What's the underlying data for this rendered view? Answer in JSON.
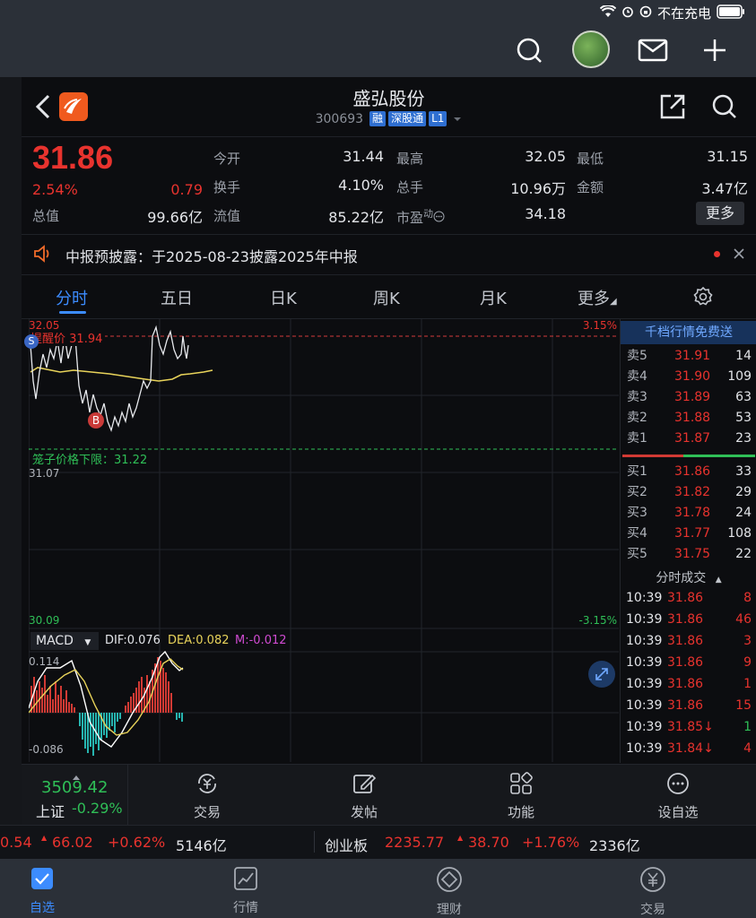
{
  "status": {
    "charging_text": "不在充电"
  },
  "stock": {
    "name": "盛弘股份",
    "code": "300693",
    "tags": [
      "融",
      "深股通",
      "L1"
    ],
    "price": "31.86",
    "change_pct": "2.54%",
    "change": "0.79"
  },
  "stats": {
    "open_label": "今开",
    "open_value": "31.44",
    "high_label": "最高",
    "high_value": "32.05",
    "low_label": "最低",
    "low_value": "31.15",
    "turnover_label": "换手",
    "turnover_value": "4.10%",
    "volume_label": "总手",
    "volume_value": "10.96万",
    "amount_label": "金额",
    "amount_value": "3.47亿",
    "mktcap_label": "总值",
    "mktcap_value": "99.66亿",
    "float_label": "流值",
    "float_value": "85.22亿",
    "pe_label": "市盈",
    "pe_sup": "动",
    "pe_value": "34.18",
    "more_label": "更多"
  },
  "notice": {
    "text": "中报预披露：于2025-08-23披露2025年中报"
  },
  "tabs": [
    "分时",
    "五日",
    "日K",
    "周K",
    "月K",
    "更多"
  ],
  "chart": {
    "top_price": "32.05",
    "mid_price": "31.07",
    "bottom_price": "30.09",
    "top_pct": "3.15%",
    "bottom_pct": "-3.15%",
    "reminder_label": "提醒价",
    "reminder_value": "31.94",
    "cage_label": "笼子价格下限：31.22",
    "marker_s": "S",
    "marker_b": "B",
    "macd_label": "MACD",
    "dif": "DIF:0.076",
    "dea": "DEA:0.082",
    "m": "M:-0.012",
    "macd_top": "0.114",
    "macd_bottom": "-0.086"
  },
  "orderbook": {
    "header": "千档行情免费送",
    "asks": [
      {
        "name": "卖5",
        "price": "31.91",
        "qty": "14"
      },
      {
        "name": "卖4",
        "price": "31.90",
        "qty": "109"
      },
      {
        "name": "卖3",
        "price": "31.89",
        "qty": "63"
      },
      {
        "name": "卖2",
        "price": "31.88",
        "qty": "53"
      },
      {
        "name": "卖1",
        "price": "31.87",
        "qty": "23"
      }
    ],
    "bids": [
      {
        "name": "买1",
        "price": "31.86",
        "qty": "33"
      },
      {
        "name": "买2",
        "price": "31.82",
        "qty": "29"
      },
      {
        "name": "买3",
        "price": "31.78",
        "qty": "24"
      },
      {
        "name": "买4",
        "price": "31.77",
        "qty": "108"
      },
      {
        "name": "买5",
        "price": "31.75",
        "qty": "22"
      }
    ],
    "trades_header": "分时成交",
    "trades": [
      {
        "time": "10:39",
        "price": "31.86",
        "vol": "8",
        "dir": "up"
      },
      {
        "time": "10:39",
        "price": "31.86",
        "vol": "46",
        "dir": "up"
      },
      {
        "time": "10:39",
        "price": "31.86",
        "vol": "3",
        "dir": "up"
      },
      {
        "time": "10:39",
        "price": "31.86",
        "vol": "9",
        "dir": "up"
      },
      {
        "time": "10:39",
        "price": "31.86",
        "vol": "1",
        "dir": "up"
      },
      {
        "time": "10:39",
        "price": "31.86",
        "vol": "15",
        "dir": "up"
      },
      {
        "time": "10:39",
        "price": "31.85↓",
        "vol": "1",
        "dir": "down"
      },
      {
        "time": "10:39",
        "price": "31.84↓",
        "vol": "4",
        "dir": "down"
      }
    ]
  },
  "index": {
    "value": "3509.42",
    "name": "上证",
    "change": "-0.29%"
  },
  "tools": [
    "交易",
    "发帖",
    "功能",
    "设自选"
  ],
  "ticker": {
    "left_value": "0.54",
    "left_change": "66.02",
    "left_pct": "+0.62%",
    "left_amount": "5146亿",
    "name": "创业板",
    "value": "2235.77",
    "change": "38.70",
    "pct": "+1.76%",
    "amount": "2336亿"
  },
  "tabbar": [
    "自选",
    "行情",
    "理财",
    "交易"
  ],
  "colors": {
    "up": "#e8332e",
    "down": "#2fbf57",
    "accent": "#2f6fd1"
  }
}
